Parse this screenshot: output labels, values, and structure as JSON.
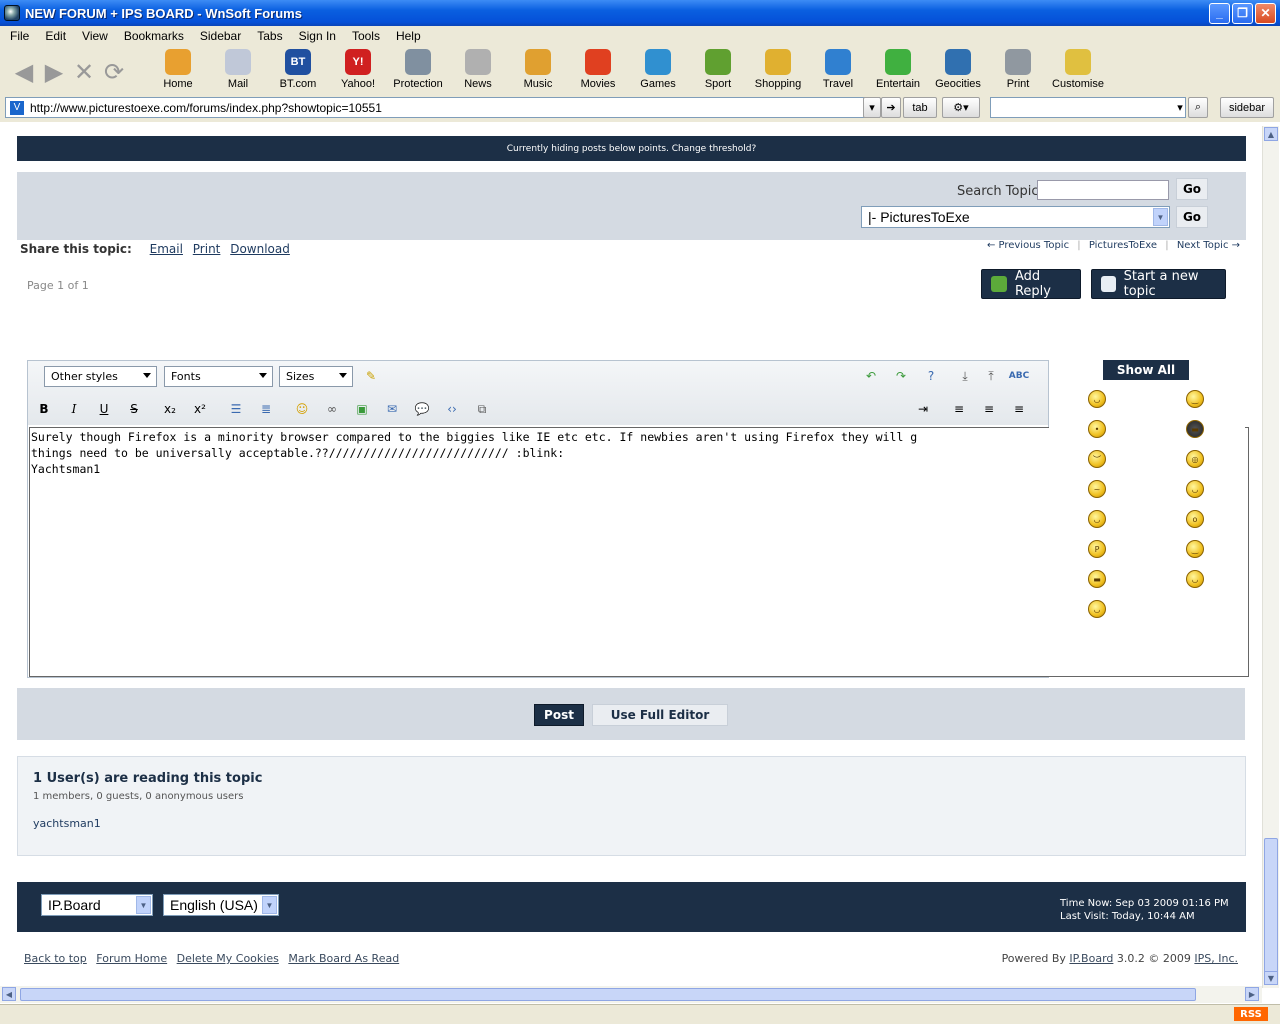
{
  "window": {
    "title": "NEW FORUM + IPS BOARD - WnSoft Forums"
  },
  "menu": [
    "File",
    "Edit",
    "View",
    "Bookmarks",
    "Sidebar",
    "Tabs",
    "Sign In",
    "Tools",
    "Help"
  ],
  "toolbar": {
    "buttons": [
      {
        "label": "Home",
        "icon": "home-icon",
        "color": "#e8a030"
      },
      {
        "label": "Mail",
        "icon": "mail-icon",
        "color": "#c0c8d8"
      },
      {
        "label": "BT.com",
        "icon": "bt-icon",
        "color": "#2050a0",
        "glyph": "BT"
      },
      {
        "label": "Yahoo!",
        "icon": "yahoo-icon",
        "color": "#d02020",
        "glyph": "Y!"
      },
      {
        "label": "Protection",
        "icon": "shield-icon",
        "color": "#8090a0"
      },
      {
        "label": "News",
        "icon": "news-icon",
        "color": "#b0b0b0"
      },
      {
        "label": "Music",
        "icon": "music-icon",
        "color": "#e0a030"
      },
      {
        "label": "Movies",
        "icon": "movies-icon",
        "color": "#e04020"
      },
      {
        "label": "Games",
        "icon": "games-icon",
        "color": "#3090d0"
      },
      {
        "label": "Sport",
        "icon": "sport-icon",
        "color": "#60a030"
      },
      {
        "label": "Shopping",
        "icon": "shopping-icon",
        "color": "#e0b030"
      },
      {
        "label": "Travel",
        "icon": "travel-icon",
        "color": "#3080d0"
      },
      {
        "label": "Entertain",
        "icon": "entertain-icon",
        "color": "#40b040"
      },
      {
        "label": "Geocities",
        "icon": "globe-icon",
        "color": "#3070b0"
      },
      {
        "label": "Print",
        "icon": "print-icon",
        "color": "#9098a0"
      },
      {
        "label": "Customise",
        "icon": "pencil-icon",
        "color": "#e0c040"
      }
    ]
  },
  "address": {
    "url": "http://www.picturestoexe.com/forums/index.php?showtopic=10551",
    "tab_label": "tab",
    "sidebar_label": "sidebar"
  },
  "page": {
    "threshold_msg": "Currently hiding posts below points. Change threshold?",
    "search_label": "Search Topic",
    "go_label": "Go",
    "forum_select": "|- PicturesToExe",
    "share_label": "Share this topic:",
    "share_links": [
      "Email",
      "Print",
      "Download"
    ],
    "prev_topic": "← Previous Topic",
    "forum_link": "PicturesToExe",
    "next_topic": "Next Topic →",
    "page_info": "Page 1 of 1",
    "add_reply": "Add Reply",
    "new_topic": "Start a new topic"
  },
  "editor": {
    "styles": "Other styles",
    "fonts": "Fonts",
    "sizes": "Sizes",
    "text": "Surely though Firefox is a minority browser compared to the biggies like IE etc etc. If newbies aren't using Firefox they will g\nthings need to be universally acceptable.??////////////////////////// :blink:\nYachtsman1",
    "show_all": "Show All"
  },
  "post": {
    "post_label": "Post",
    "full_editor_label": "Use Full Editor"
  },
  "readers": {
    "title": "1 User(s) are reading this topic",
    "detail": "1 members, 0 guests, 0 anonymous users",
    "user": "yachtsman1"
  },
  "footer": {
    "skin": "IP.Board",
    "language": "English (USA)",
    "time_now": "Time Now: Sep 03 2009 01:16 PM",
    "last_visit": "Last Visit: Today, 10:44 AM",
    "links": [
      "Back to top",
      "Forum Home",
      "Delete My Cookies",
      "Mark Board As Read"
    ],
    "powered_prefix": "Powered By",
    "powered_link": "IP.Board",
    "powered_suffix": "3.0.2 © 2009",
    "ips_link": "IPS, Inc."
  },
  "status": {
    "rss": "RSS"
  }
}
